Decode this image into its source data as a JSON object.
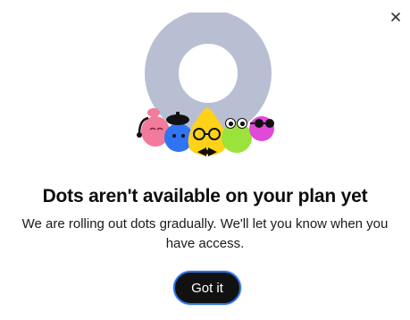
{
  "dialog": {
    "title": "Dots aren't available on your plan yet",
    "message": "We are rolling out dots gradually. We'll let you know when you have access.",
    "primary_button_label": "Got it",
    "close_icon": "close-icon",
    "illustration_icon": "dots-characters-illustration"
  },
  "colors": {
    "ring": "#b8bfd2",
    "pink_dot": "#f27a9a",
    "blue_dot": "#2f74f2",
    "yellow_dot": "#ffd21a",
    "green_dot": "#9be23a",
    "magenta_dot": "#e04ad6",
    "button_bg": "#111111",
    "button_focus_ring": "#2f6fe0"
  }
}
